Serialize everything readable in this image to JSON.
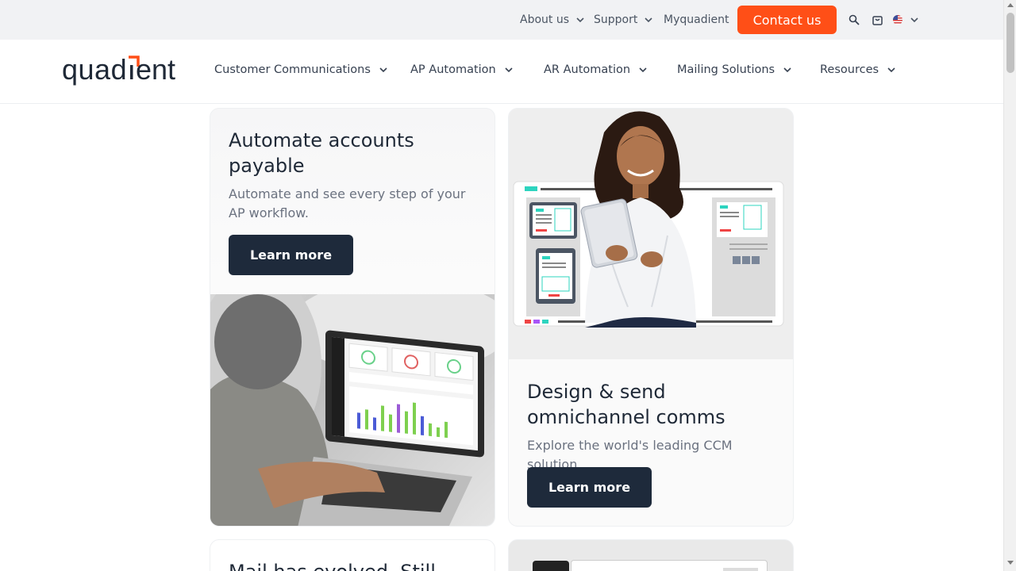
{
  "topbar": {
    "about_label": "About us",
    "support_label": "Support",
    "myquadient_label": "Myquadient",
    "contact_label": "Contact us"
  },
  "logo": {
    "text": "quadient",
    "accent_color": "#ff4f17"
  },
  "nav": {
    "items": [
      {
        "label": "Customer Communications"
      },
      {
        "label": "AP Automation"
      },
      {
        "label": "AR Automation"
      },
      {
        "label": "Mailing Solutions"
      },
      {
        "label": "Resources"
      }
    ]
  },
  "cards": [
    {
      "title": "Automate accounts payable",
      "desc": "Automate and see every step of your AP workflow.",
      "button": "Learn more",
      "image_icon": "laptop-dashboard-photo"
    },
    {
      "title": "Design & send omnichannel comms",
      "desc": "Explore the world's leading CCM solution.",
      "button": "Learn more",
      "image_icon": "woman-with-tablet-photo"
    },
    {
      "title": "Mail has evolved. Still"
    }
  ],
  "colors": {
    "accent": "#ff4f17",
    "button_dark": "#1e2a3b",
    "topbar_bg": "#f1f2f4"
  }
}
